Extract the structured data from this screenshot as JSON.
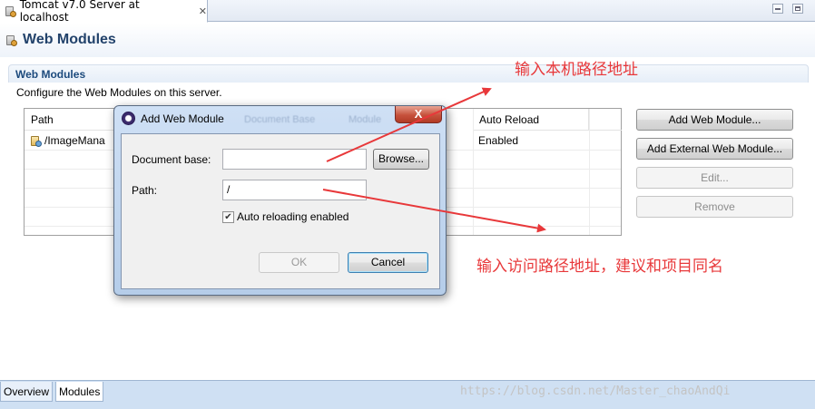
{
  "editor_tab": {
    "title": "Tomcat v7.0 Server at localhost",
    "close_glyph": "✕"
  },
  "page_title": "Web Modules",
  "section": {
    "title": "Web Modules",
    "description": "Configure the Web Modules on this server."
  },
  "table": {
    "columns": [
      "Path",
      "Auto Reload"
    ],
    "ghost_columns": [
      "Document Base",
      "Module"
    ],
    "rows": [
      {
        "path": "/ImageMana",
        "auto_reload": "Enabled"
      }
    ]
  },
  "buttons": {
    "add_web_module": "Add Web Module...",
    "add_external": "Add External Web Module...",
    "edit": "Edit...",
    "remove": "Remove"
  },
  "dialog": {
    "title": "Add Web Module",
    "close_glyph": "X",
    "document_base_label": "Document base:",
    "document_base_value": "",
    "browse": "Browse...",
    "path_label": "Path:",
    "path_value": "/",
    "checkbox_label": "Auto reloading enabled",
    "checkbox_checked": true,
    "check_glyph": "✔",
    "ok": "OK",
    "cancel": "Cancel"
  },
  "bottom_tabs": [
    "Overview",
    "Modules"
  ],
  "watermark": "https://blog.csdn.net/Master_chaoAndQi",
  "annotations": {
    "top": "输入本机路径地址",
    "bottom": "输入访问路径地址，建议和项目同名",
    "color": "#e8383a"
  }
}
